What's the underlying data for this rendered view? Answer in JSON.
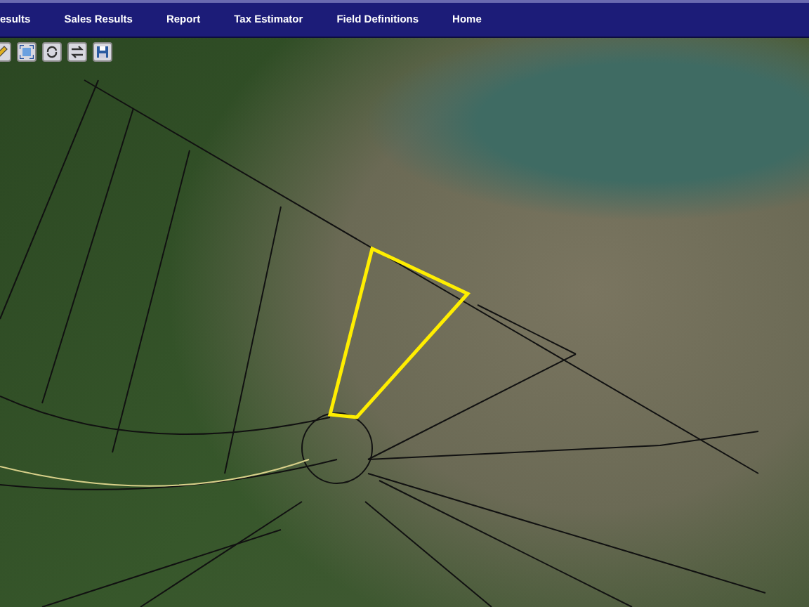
{
  "nav": [
    {
      "label": "esults"
    },
    {
      "label": "Sales Results"
    },
    {
      "label": "Report"
    },
    {
      "label": "Tax Estimator"
    },
    {
      "label": "Field Definitions"
    },
    {
      "label": "Home"
    }
  ],
  "toolbar": [
    {
      "kind": "pencil"
    },
    {
      "kind": "extent"
    },
    {
      "kind": "cycle"
    },
    {
      "kind": "swap"
    },
    {
      "kind": "save"
    }
  ]
}
